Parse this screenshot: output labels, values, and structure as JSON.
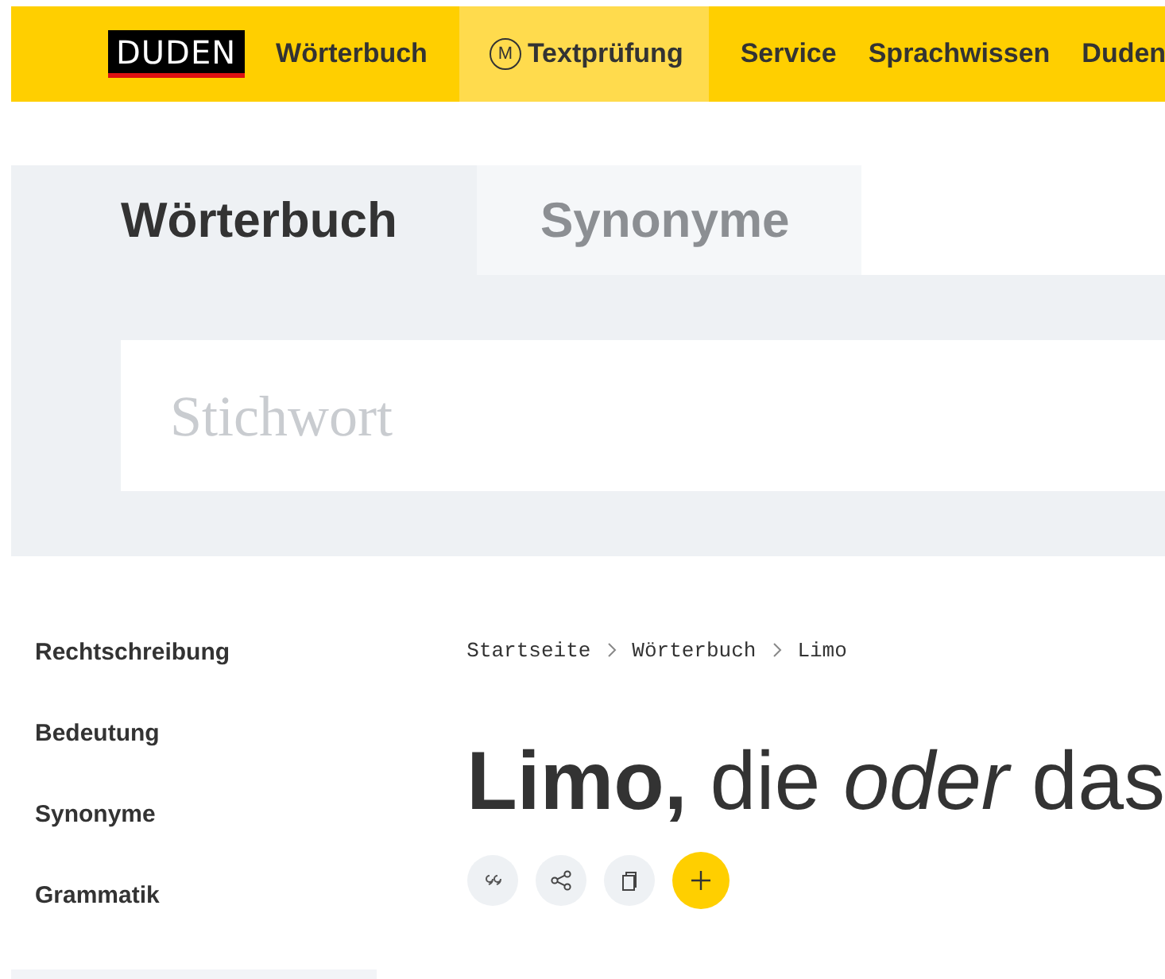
{
  "header": {
    "logo": "DUDEN",
    "nav": [
      {
        "label": "Wörterbuch",
        "selected": false,
        "kind": "text"
      },
      {
        "label": "Textprüfung",
        "selected": true,
        "kind": "badge",
        "badge": "M"
      },
      {
        "label": "Service",
        "selected": false,
        "kind": "text"
      },
      {
        "label": "Sprachwissen",
        "selected": false,
        "kind": "text"
      },
      {
        "label": "Duden",
        "selected": false,
        "kind": "text"
      }
    ]
  },
  "search": {
    "tabs": [
      {
        "label": "Wörterbuch",
        "selected": true
      },
      {
        "label": "Synonyme",
        "selected": false
      }
    ],
    "placeholder": "Stichwort"
  },
  "sidebar": {
    "items": [
      {
        "label": "Rechtschreibung"
      },
      {
        "label": "Bedeutung"
      },
      {
        "label": "Synonyme"
      },
      {
        "label": "Grammatik"
      }
    ]
  },
  "breadcrumb": [
    "Startseite",
    "Wörterbuch",
    "Limo"
  ],
  "headword": "**Limo,** die *oder* das",
  "actions": [
    {
      "kind": "quote",
      "primary": false
    },
    {
      "kind": "share",
      "primary": false
    },
    {
      "kind": "copy",
      "primary": false
    },
    {
      "kind": "add",
      "primary": true
    }
  ]
}
